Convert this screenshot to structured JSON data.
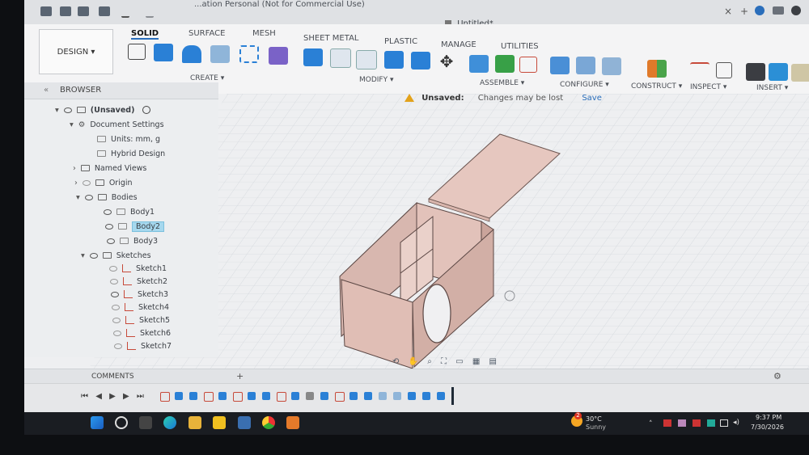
{
  "window": {
    "title": "...ation Personal (Not for Commercial Use)",
    "doc_tab": "Untitled*"
  },
  "workspace": {
    "design_label": "DESIGN"
  },
  "ribbon": {
    "tabs": [
      {
        "label": "SOLID",
        "active": true
      },
      {
        "label": "SURFACE"
      },
      {
        "label": "MESH"
      },
      {
        "label": "SHEET METAL"
      },
      {
        "label": "PLASTIC"
      },
      {
        "label": "MANAGE"
      },
      {
        "label": "UTILITIES"
      }
    ],
    "groups": [
      "CREATE",
      "MODIFY",
      "ASSEMBLE",
      "CONFIGURE",
      "CONSTRUCT",
      "INSPECT",
      "INSERT"
    ]
  },
  "browser": {
    "title": "BROWSER",
    "items": [
      {
        "label": "(Unsaved)"
      },
      {
        "label": "Document Settings"
      },
      {
        "label": "Units: mm, g"
      },
      {
        "label": "Hybrid Design"
      },
      {
        "label": "Named Views"
      },
      {
        "label": "Origin"
      },
      {
        "label": "Bodies"
      },
      {
        "label": "Body1"
      },
      {
        "label": "Body2"
      },
      {
        "label": "Body3"
      },
      {
        "label": "Sketches"
      },
      {
        "label": "Sketch1"
      },
      {
        "label": "Sketch2"
      },
      {
        "label": "Sketch3"
      },
      {
        "label": "Sketch4"
      },
      {
        "label": "Sketch5"
      },
      {
        "label": "Sketch6"
      },
      {
        "label": "Sketch7"
      }
    ]
  },
  "unsaved_bar": {
    "label": "Unsaved:",
    "message": "Changes may be lost",
    "save": "Save"
  },
  "comments": {
    "label": "COMMENTS"
  },
  "taskbar": {
    "weather_temp": "30°C",
    "weather_desc": "Sunny",
    "weather_badge": "2",
    "time": "9:37 PM",
    "date": "7/30/2026"
  },
  "colors": {
    "accent": "#2a6ebb",
    "selection": "#a6d8ee",
    "wood": "#e7c9c2",
    "warning": "#e3a21a"
  }
}
